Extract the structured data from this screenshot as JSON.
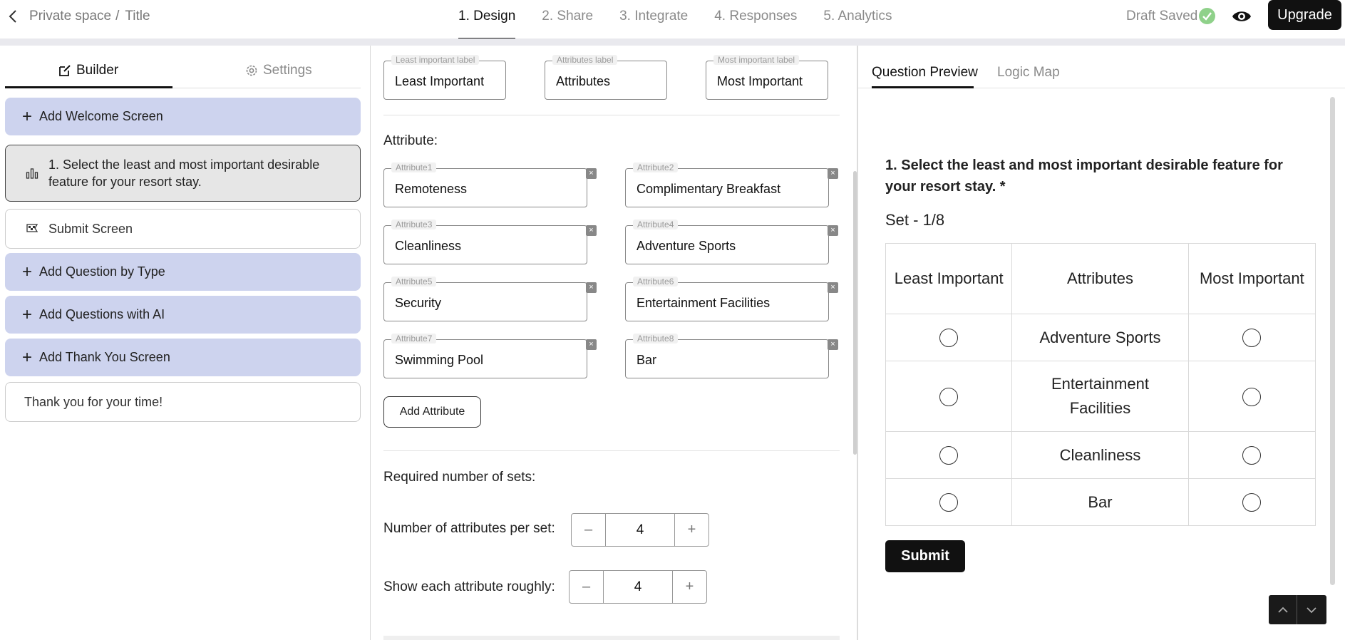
{
  "header": {
    "breadcrumb": {
      "space": "Private space",
      "separator": "/",
      "title": "Title"
    },
    "steps": [
      {
        "label": "1. Design",
        "active": true
      },
      {
        "label": "2. Share",
        "active": false
      },
      {
        "label": "3. Integrate",
        "active": false
      },
      {
        "label": "4. Responses",
        "active": false
      },
      {
        "label": "5. Analytics",
        "active": false
      }
    ],
    "status": "Draft Saved",
    "upgrade_label": "Upgrade"
  },
  "sidebar": {
    "tabs": {
      "builder": "Builder",
      "settings": "Settings"
    },
    "items": {
      "add_welcome": "Add Welcome Screen",
      "question1": "1. Select the least and most important desirable feature for your resort stay.",
      "submit_screen": "Submit Screen",
      "add_by_type": "Add Question by Type",
      "add_with_ai": "Add Questions with AI",
      "add_thank_you": "Add Thank You Screen",
      "thank_you_text": "Thank you for your time!"
    }
  },
  "editor": {
    "labels": [
      {
        "legend": "Least important label",
        "value": "Least Important"
      },
      {
        "legend": "Attributes label",
        "value": "Attributes"
      },
      {
        "legend": "Most important label",
        "value": "Most Important"
      }
    ],
    "attribute_heading": "Attribute:",
    "attributes": [
      {
        "legend": "Attribute1",
        "value": "Remoteness"
      },
      {
        "legend": "Attribute2",
        "value": "Complimentary Breakfast"
      },
      {
        "legend": "Attribute3",
        "value": "Cleanliness"
      },
      {
        "legend": "Attribute4",
        "value": "Adventure Sports"
      },
      {
        "legend": "Attribute5",
        "value": "Security"
      },
      {
        "legend": "Attribute6",
        "value": "Entertainment Facilities"
      },
      {
        "legend": "Attribute7",
        "value": "Swimming Pool"
      },
      {
        "legend": "Attribute8",
        "value": "Bar"
      }
    ],
    "remove_symbol": "×",
    "add_attribute_label": "Add Attribute",
    "required_sets_label": "Required number of sets:",
    "per_set_label": "Number of attributes per set:",
    "per_set_value": "4",
    "roughly_label": "Show each attribute roughly:",
    "roughly_value": "4",
    "minus": "–",
    "plus": "+"
  },
  "preview": {
    "tabs": {
      "question_preview": "Question Preview",
      "logic_map": "Logic Map"
    },
    "question_title": "1. Select the least and most important desirable feature for your resort stay. *",
    "set_label": "Set - 1/8",
    "columns": {
      "least": "Least Important",
      "attributes": "Attributes",
      "most": "Most Important"
    },
    "rows": [
      "Adventure Sports",
      "Entertainment Facilities",
      "Cleanliness",
      "Bar"
    ],
    "submit_label": "Submit"
  }
}
